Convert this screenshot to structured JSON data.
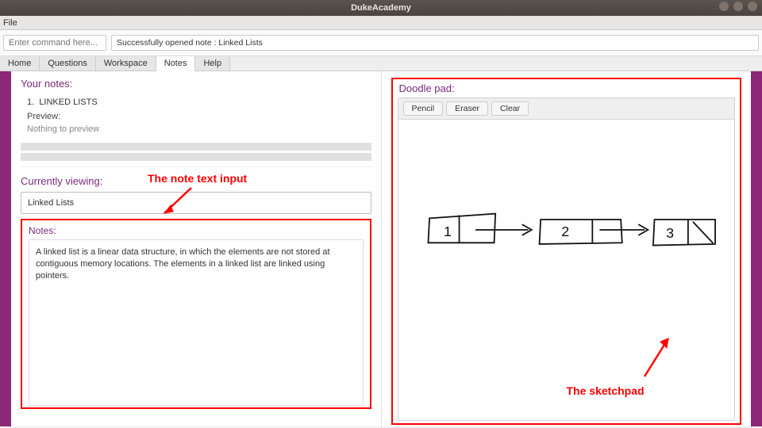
{
  "window": {
    "title": "DukeAcademy"
  },
  "menubar": {
    "file": "File"
  },
  "command_bar": {
    "placeholder": "Enter command here...",
    "status": "Successfully opened note : Linked Lists"
  },
  "tabs": [
    {
      "label": "Home"
    },
    {
      "label": "Questions"
    },
    {
      "label": "Workspace"
    },
    {
      "label": "Notes",
      "active": true
    },
    {
      "label": "Help"
    }
  ],
  "your_notes": {
    "heading": "Your notes:",
    "items": [
      {
        "index": "1.",
        "title": "LINKED LISTS"
      }
    ],
    "preview_label": "Preview:",
    "preview_empty": "Nothing to preview"
  },
  "currently_viewing": {
    "label": "Currently viewing:",
    "value": "Linked Lists"
  },
  "notes_editor": {
    "heading": "Notes:",
    "body": "A linked list is a linear data structure, in which the elements are not stored at contiguous memory locations. The elements in a linked list are linked using pointers."
  },
  "doodle": {
    "heading": "Doodle pad:",
    "tools": {
      "pencil": "Pencil",
      "eraser": "Eraser",
      "clear": "Clear"
    }
  },
  "annotations": {
    "note_input": "The note text input",
    "sketchpad": "The sketchpad"
  }
}
